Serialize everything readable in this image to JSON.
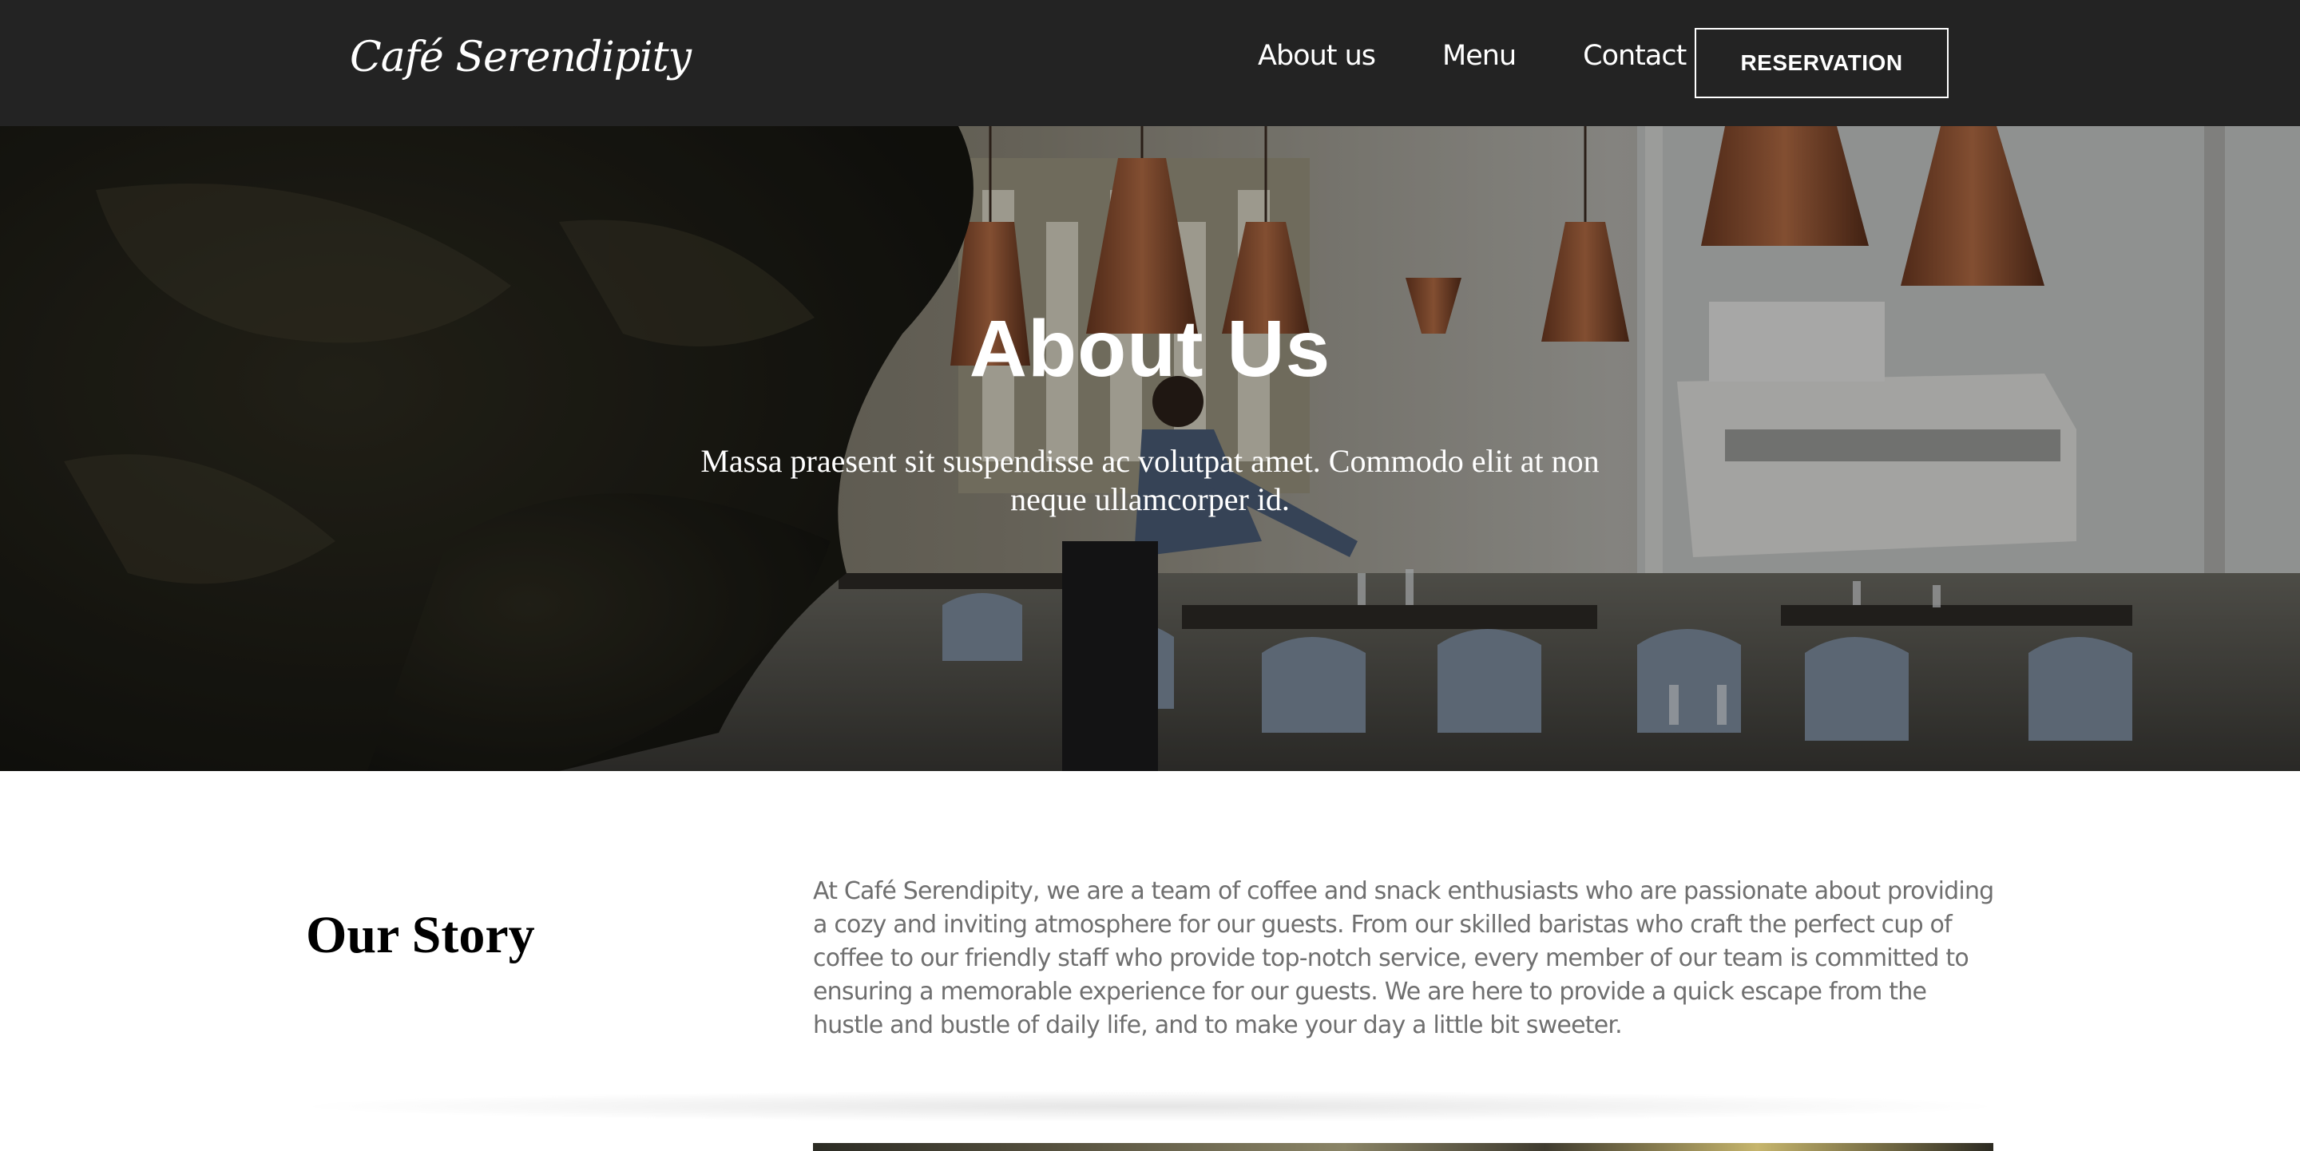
{
  "brand": {
    "name": "Café Serendipity"
  },
  "nav": {
    "links": [
      {
        "label": "About us"
      },
      {
        "label": "Menu"
      },
      {
        "label": "Contact"
      }
    ],
    "reservation_label": "RESERVATION"
  },
  "hero": {
    "title": "About Us",
    "subtitle": "Massa praesent sit suspendisse ac volutpat amet. Commodo elit at non neque ullamcorper id."
  },
  "story": {
    "heading": "Our Story",
    "body": "At Café Serendipity, we are a team of coffee and snack enthusiasts who are passionate about providing a cozy and inviting atmosphere for our guests. From our skilled baristas who craft the perfect cup of coffee to our friendly staff who provide top-notch service, every member of our team is committed to ensuring a memorable experience for our guests. We are here to provide a quick escape from the hustle and bustle of daily life, and to make your day a little bit sweeter."
  },
  "colors": {
    "nav_bg": "#232323",
    "story_text": "#6f6f6f"
  }
}
